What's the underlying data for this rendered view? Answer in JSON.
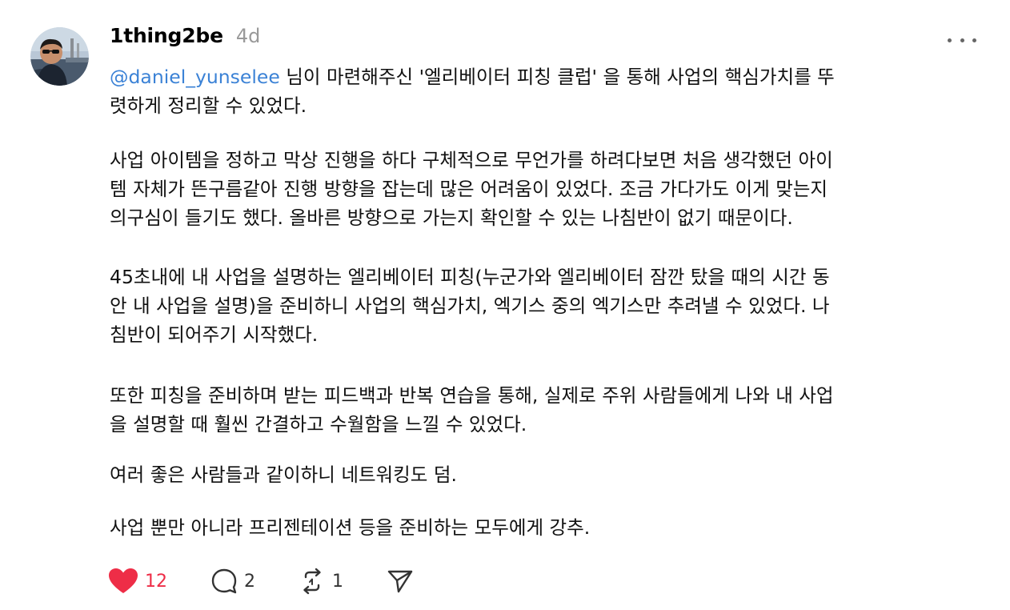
{
  "post": {
    "username": "1thing2be",
    "time_ago": "4d",
    "mention": "@daniel_yunselee",
    "p1_line1_rest": " 님이 마련해주신 '엘리베이터 피칭 클럽' 을 통해 사업의 핵심가치를 뚜",
    "p1_line2": "렷하게 정리할 수 있었다.",
    "p2_line1": "사업 아이템을 정하고 막상 진행을 하다 구체적으로 무언가를 하려다보면 처음 생각했던 아이",
    "p2_line2": "템 자체가 뜬구름같아 진행 방향을 잡는데 많은 어려움이 있었다. 조금 가다가도 이게 맞는지",
    "p2_line3": "의구심이 들기도 했다. 올바른 방향으로 가는지 확인할 수 있는 나침반이 없기 때문이다.",
    "p3_line1": "45초내에 내 사업을 설명하는 엘리베이터 피칭(누군가와 엘리베이터 잠깐 탔을 때의 시간 동",
    "p3_line2": "안 내 사업을 설명)을 준비하니 사업의 핵심가치, 엑기스 중의 엑기스만 추려낼 수 있었다. 나",
    "p3_line3": "침반이 되어주기 시작했다.",
    "p4_line1": "또한 피칭을 준비하며 받는 피드백과 반복 연습을 통해, 실제로 주위 사람들에게 나와 내 사업",
    "p4_line2": "을 설명할 때 훨씬 간결하고 수월함을 느낄 수 있었다.",
    "p5": "여러 좋은 사람들과 같이하니 네트워킹도 덤.",
    "p6": "사업 뿐만 아니라 프리젠테이션 등을 준비하는 모두에게 강추."
  },
  "actions": {
    "like_count": "12",
    "reply_count": "2",
    "repost_count": "1"
  },
  "colors": {
    "like": "#ee2d47",
    "mention": "#3b82d6",
    "muted": "#999999"
  },
  "icons": {
    "avatar": "avatar-photo",
    "more": "more-horizontal-icon",
    "like": "heart-icon",
    "reply": "comment-icon",
    "repost": "repost-icon",
    "share": "send-icon"
  }
}
